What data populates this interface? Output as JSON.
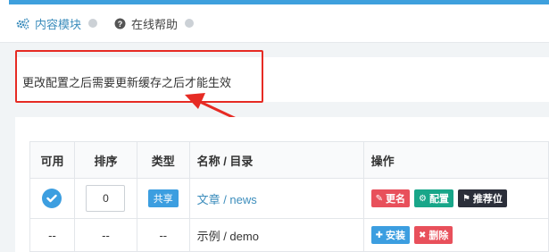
{
  "tabs": [
    {
      "label": "内容模块",
      "icon": "gears-icon",
      "active": true
    },
    {
      "label": "在线帮助",
      "icon": "question-circle-icon",
      "active": false
    }
  ],
  "notice": {
    "text": "更改配置之后需要更新缓存之后才能生效"
  },
  "table": {
    "headers": {
      "enabled": "可用",
      "order": "排序",
      "type": "类型",
      "name": "名称 / 目录",
      "ops": "操作"
    },
    "rows": [
      {
        "enabled": "",
        "order": "0",
        "type": "共享",
        "name": "文章 / news",
        "buttons": [
          "更名",
          "配置",
          "推荐位"
        ]
      },
      {
        "enabled": "--",
        "order": "--",
        "type": "--",
        "name": "示例 / demo",
        "buttons": [
          "安装",
          "删除"
        ]
      }
    ]
  },
  "colors": {
    "accent": "#3ea0dd",
    "highlight": "#e62b24",
    "link": "#3c8dbc",
    "rename": "#e8505b",
    "config": "#18a689",
    "recommend": "#2b2f3a",
    "install": "#3c9ee0",
    "delete": "#e8505b"
  }
}
